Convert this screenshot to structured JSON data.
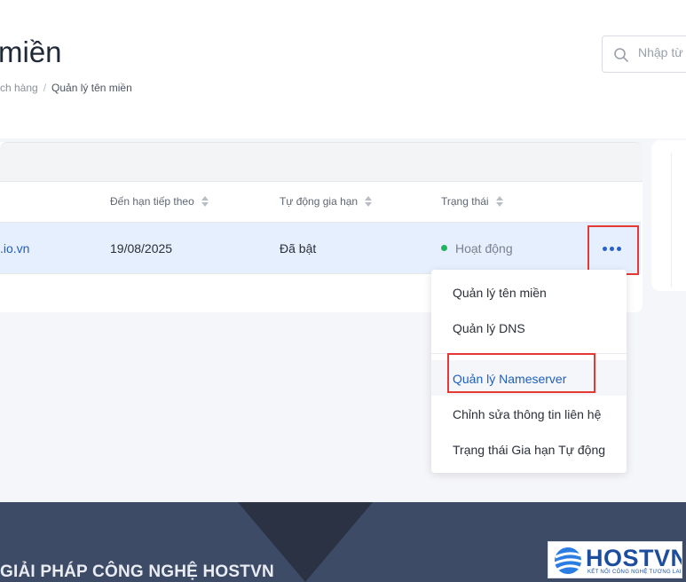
{
  "header": {
    "title": "miền",
    "breadcrumb": [
      "ch hàng",
      "Quản lý tên miền"
    ],
    "breadcrumb_sep": "/"
  },
  "search": {
    "placeholder": "Nhập từ"
  },
  "table": {
    "columns": [
      "Đến hạn tiếp theo",
      "Tự động gia hạn",
      "Trạng thái"
    ],
    "rows": [
      {
        "domain": ".io.vn",
        "due": "19/08/2025",
        "auto_renew": "Đã bật",
        "status": "Hoạt động"
      }
    ]
  },
  "menu": {
    "items": [
      "Quản lý tên miền",
      "Quản lý DNS",
      "Quản lý Nameserver",
      "Chỉnh sửa thông tin liên hệ",
      "Trạng thái Gia hạn Tự động"
    ]
  },
  "footer": {
    "text": "GIẢI PHÁP CÔNG NGHỆ HOSTVN"
  },
  "logo": {
    "brand": "HOSTVN",
    "tagline": "KẾT NỐI CÔNG NGHỆ TƯƠNG LAI"
  },
  "colors": {
    "accent": "#1f5fbf",
    "highlight": "#e53935",
    "status_active": "#22b35e",
    "footer_bg": "#3d4b66"
  }
}
